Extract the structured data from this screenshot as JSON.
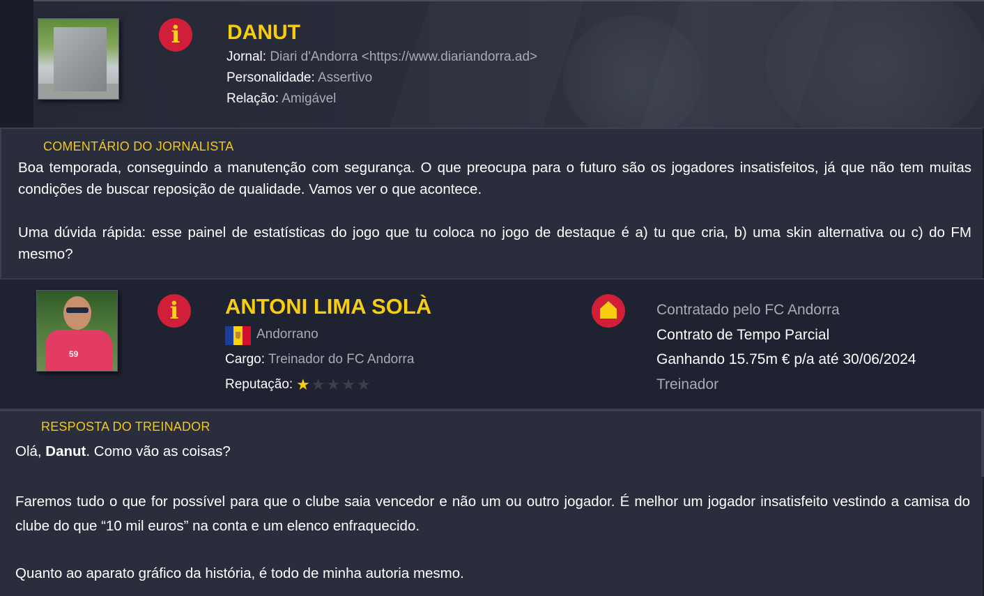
{
  "journalist": {
    "name": "DANUT",
    "fields": [
      {
        "label": "Jornal:",
        "value": "Diari d'Andorra <https://www.diariandorra.ad>"
      },
      {
        "label": "Personalidade:",
        "value": "Assertivo"
      },
      {
        "label": "Relação:",
        "value": "Amigável"
      }
    ]
  },
  "journalist_comment": {
    "label": "COMENTÁRIO DO JORNALISTA",
    "paragraph1": "Boa temporada, conseguindo a manutenção com segurança. O que preocupa para o futuro são os jogadores insatisfeitos, já que não tem muitas condições de buscar reposição de qualidade. Vamos ver o que acontece.",
    "paragraph2": "Uma dúvida rápida: esse painel de estatísticas do jogo que tu coloca no jogo de destaque é a) tu que cria, b) uma skin alternativa ou c) do FM mesmo?"
  },
  "coach": {
    "name": "ANTONI LIMA SOLÀ",
    "nationality": "Andorrano",
    "role_label": "Cargo:",
    "role_value": "Treinador do FC Andorra",
    "reputation_label": "Reputação:",
    "reputation_stars": 1,
    "reputation_max": 5,
    "contract": {
      "hired_by": "Contratado pelo FC Andorra",
      "type": "Contrato de Tempo Parcial",
      "salary": "Ganhando 15.75m € p/a até 30/06/2024",
      "position": "Treinador"
    }
  },
  "coach_reply": {
    "label": "RESPOSTA DO TREINADOR",
    "greeting_pre": "Olá, ",
    "greeting_name": "Danut",
    "greeting_post": ". Como vão as coisas?",
    "paragraph1": "Faremos tudo o que for possível para que o clube saia vencedor e não um ou outro jogador. É melhor um jogador insatisfeito vestindo a camisa do clube do que “10 mil euros” na conta e um elenco enfraquecido.",
    "paragraph2": "Quanto ao aparato gráfico da história, é todo de minha autoria mesmo."
  },
  "colors": {
    "accent_yellow": "#f6cd11",
    "icon_red": "#d11f3a",
    "panel_bg": "#2a2d3b",
    "header_bg": "#1f2230",
    "muted_text": "#a8abb4"
  },
  "icons": [
    "info-icon",
    "home-icon",
    "star-icon",
    "andorra-flag-icon"
  ]
}
